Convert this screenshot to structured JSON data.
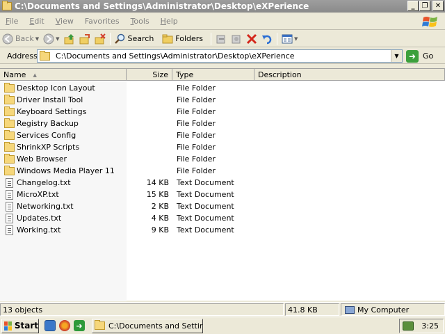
{
  "window": {
    "title": "C:\\Documents and Settings\\Administrator\\Desktop\\eXPerience",
    "minimize_glyph": "_",
    "maximize_glyph": "❐",
    "close_glyph": "✕"
  },
  "menu": [
    {
      "key": "F",
      "rest": "ile"
    },
    {
      "key": "E",
      "rest": "dit"
    },
    {
      "key": "V",
      "rest": "iew"
    },
    {
      "key": "Favorites",
      "rest": ""
    },
    {
      "key": "T",
      "rest": "ools"
    },
    {
      "key": "H",
      "rest": "elp"
    }
  ],
  "toolbar": {
    "back_label": "Back",
    "search_label": "Search",
    "folders_label": "Folders"
  },
  "address": {
    "label": "Address",
    "value": "C:\\Documents and Settings\\Administrator\\Desktop\\eXPerience",
    "go_label": "Go"
  },
  "columns": {
    "name": "Name",
    "size": "Size",
    "type": "Type",
    "description": "Description"
  },
  "files": [
    {
      "name": "Desktop Icon Layout",
      "size": "",
      "type": "File Folder",
      "kind": "folder"
    },
    {
      "name": "Driver Install Tool",
      "size": "",
      "type": "File Folder",
      "kind": "folder"
    },
    {
      "name": "Keyboard Settings",
      "size": "",
      "type": "File Folder",
      "kind": "folder"
    },
    {
      "name": "Registry Backup",
      "size": "",
      "type": "File Folder",
      "kind": "folder"
    },
    {
      "name": "Services Config",
      "size": "",
      "type": "File Folder",
      "kind": "folder"
    },
    {
      "name": "ShrinkXP Scripts",
      "size": "",
      "type": "File Folder",
      "kind": "folder"
    },
    {
      "name": "Web Browser",
      "size": "",
      "type": "File Folder",
      "kind": "folder"
    },
    {
      "name": "Windows Media Player 11",
      "size": "",
      "type": "File Folder",
      "kind": "folder"
    },
    {
      "name": "Changelog.txt",
      "size": "14 KB",
      "type": "Text Document",
      "kind": "text"
    },
    {
      "name": "MicroXP.txt",
      "size": "15 KB",
      "type": "Text Document",
      "kind": "text"
    },
    {
      "name": "Networking.txt",
      "size": "2 KB",
      "type": "Text Document",
      "kind": "text"
    },
    {
      "name": "Updates.txt",
      "size": "4 KB",
      "type": "Text Document",
      "kind": "text"
    },
    {
      "name": "Working.txt",
      "size": "9 KB",
      "type": "Text Document",
      "kind": "text"
    }
  ],
  "status": {
    "objects": "13 objects",
    "total_size": "41.8 KB",
    "location": "My Computer"
  },
  "taskbar": {
    "start_label": "Start",
    "task_label": "C:\\Documents and Settin...",
    "clock": "3:25"
  }
}
